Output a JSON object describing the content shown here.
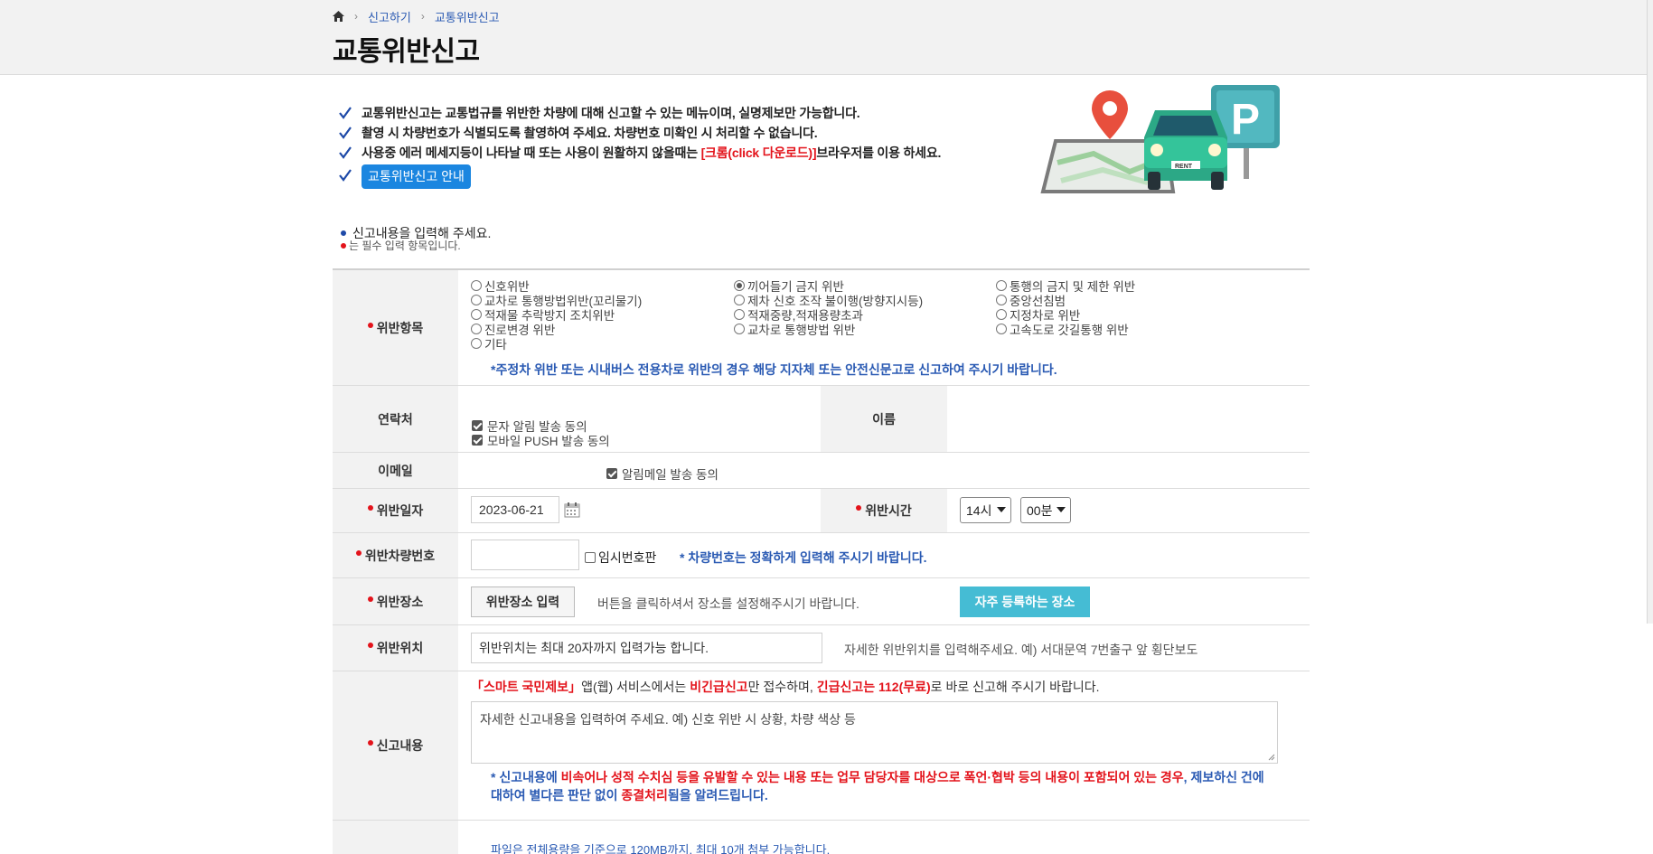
{
  "breadcrumb": {
    "home_icon": "home-icon",
    "items": [
      "신고하기",
      "교통위반신고"
    ]
  },
  "page": {
    "title": "교통위반신고"
  },
  "notice": {
    "line1": "교통위반신고는 교통법규를 위반한 차량에 대해 신고할 수 있는 메뉴이며, 실명제보만 가능합니다.",
    "line2": "촬영 시 차량번호가 식별되도록 촬영하여 주세요. 차량번호 미확인 시 처리할 수 없습니다.",
    "line3_before": "사용중 에러 메세지등이 나타날 때 또는 사용이 원활하지 않을때는 ",
    "line3_red": "[크롬(click 다운로드)]",
    "line3_after": "브라우저를 이용 하세요.",
    "guide_button": "교통위반신고 안내"
  },
  "info": {
    "enter": "신고내용을 입력해 주세요.",
    "required": "는 필수 입력 항목입니다."
  },
  "violation_item": {
    "label": "위반항목",
    "options": [
      {
        "text": "신호위반",
        "selected": false
      },
      {
        "text": "끼어들기 금지 위반",
        "selected": true
      },
      {
        "text": "통행의 금지 및 제한 위반",
        "selected": false
      },
      {
        "text": "교차로 통행방법위반(꼬리물기)",
        "selected": false
      },
      {
        "text": "제차 신호 조작 불이행(방향지시등)",
        "selected": false
      },
      {
        "text": "중앙선침범",
        "selected": false
      },
      {
        "text": "적재물 추락방지 조치위반",
        "selected": false
      },
      {
        "text": "적재중량,적재용량초과",
        "selected": false
      },
      {
        "text": "지정차로 위반",
        "selected": false
      },
      {
        "text": "진로변경 위반",
        "selected": false
      },
      {
        "text": "교차로 통행방법 위반",
        "selected": false
      },
      {
        "text": "고속도로 갓길통행 위반",
        "selected": false
      },
      {
        "text": "기타",
        "selected": false
      }
    ],
    "note": "*주정차 위반 또는 시내버스 전용차로 위반의 경우 해당 지자체 또는 안전신문고로 신고하여 주시기 바랍니다."
  },
  "contact": {
    "label": "연락처",
    "sms_consent": "문자 알림 발송 동의",
    "push_consent": "모바일 PUSH 발송 동의",
    "name_label": "이름"
  },
  "email": {
    "label": "이메일",
    "consent": "알림메일 발송 동의"
  },
  "date": {
    "label": "위반일자",
    "value": "2023-06-21",
    "calendar_icon": "calendar-icon",
    "time_label": "위반시간",
    "hour": "14시",
    "minute": "00분"
  },
  "plate": {
    "label": "위반차량번호",
    "value": "",
    "temp_plate": "임시번호판",
    "note": "* 차량번호는 정확하게 입력해 주시기 바랍니다."
  },
  "location": {
    "label": "위반장소",
    "button": "위반장소 입력",
    "hint": "버튼을 클릭하셔서 장소를 설정해주시기 바랍니다.",
    "favorite_button": "자주 등록하는 장소"
  },
  "position": {
    "label": "위반위치",
    "placeholder": "위반위치는 최대 20자까지 입력가능 합니다.",
    "hint": "자세한 위반위치를 입력해주세요. 예) 서대문역 7번출구 앞 횡단보도"
  },
  "content": {
    "label": "신고내용",
    "n1_red": "「스마트 국민제보」",
    "n1_a": "앱(웹) 서비스에서는 ",
    "n1_red2": "비긴급신고",
    "n1_b": "만 접수하며, ",
    "n1_red3": "긴급신고는 112(무료)",
    "n1_c": "로 바로 신고해 주시기 바랍니다.",
    "placeholder": "자세한 신고내용을 입력하여 주세요. 예) 신호 위반 시 상황, 차량 색상 등",
    "w_blue1": "* 신고내용에 ",
    "w_red1": "비속어나 성적 수치심 등을 유발할 수 있는 내용 또는 업무 담당자를 대상으로 폭언·협박 등의 내용이 포함되어 있는 경우",
    "w_blue2": ", 제보하신 건에",
    "w_blue3": "대하여 별다른 판단 없이 ",
    "w_red2": "종결처리",
    "w_blue4": "됨을 알려드립니다."
  },
  "attachment": {
    "note": "파일은 전체용량을 기준으로 120MB까지, 최대 10개 첨부 가능합니다."
  },
  "illustration": {
    "icon": "map-car-parking-icon"
  },
  "colors": {
    "accent_blue": "#1b86e0",
    "required_red": "#e3131b",
    "teal": "#45bcd4",
    "link_blue": "#2a5ab3"
  }
}
